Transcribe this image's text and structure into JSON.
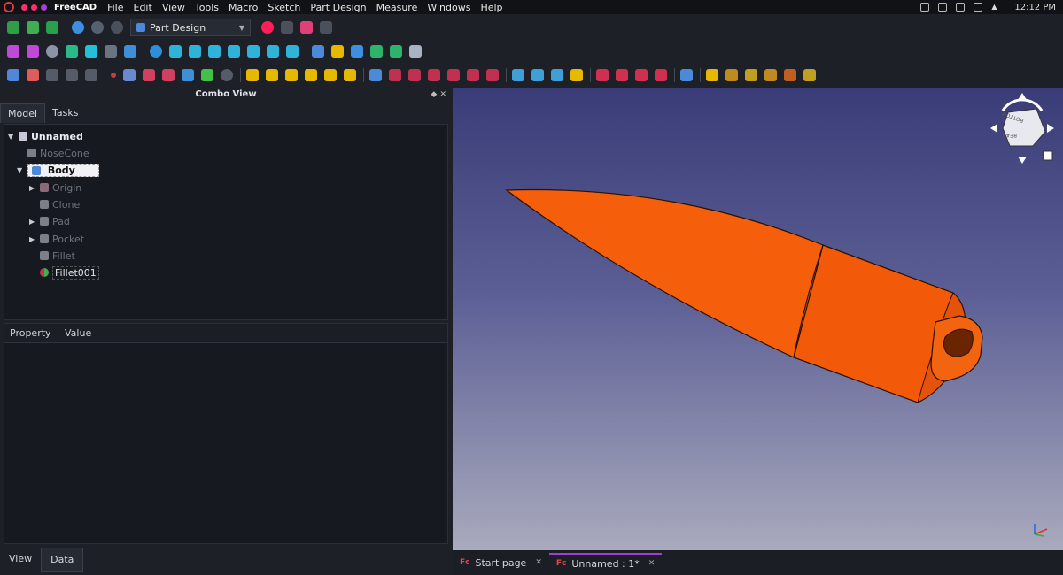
{
  "menubar": {
    "app_name": "FreeCAD",
    "items": [
      "File",
      "Edit",
      "View",
      "Tools",
      "Macro",
      "Sketch",
      "Part Design",
      "Measure",
      "Windows",
      "Help"
    ],
    "clock": "12:12 PM"
  },
  "toolbar": {
    "workbench": "Part Design"
  },
  "combo_view": {
    "title": "Combo View",
    "tabs": [
      "Model",
      "Tasks"
    ],
    "tree": {
      "root": "Unnamed",
      "nosecone": "NoseCone",
      "body": "Body",
      "children": [
        "Origin",
        "Clone",
        "Pad",
        "Pocket",
        "Fillet",
        "Fillet001"
      ]
    },
    "properties": {
      "col_property": "Property",
      "col_value": "Value"
    },
    "bottom_tabs": [
      "View",
      "Data"
    ]
  },
  "viewport": {
    "model_color": "#f25a0a",
    "navcube_faces": [
      "BOTTOM",
      "REAR"
    ]
  },
  "doc_tabs": [
    {
      "label": "Start page"
    },
    {
      "label": "Unnamed : 1*"
    }
  ],
  "colors": {
    "accent_tab": "#a040d0",
    "model": "#f25a0a"
  }
}
